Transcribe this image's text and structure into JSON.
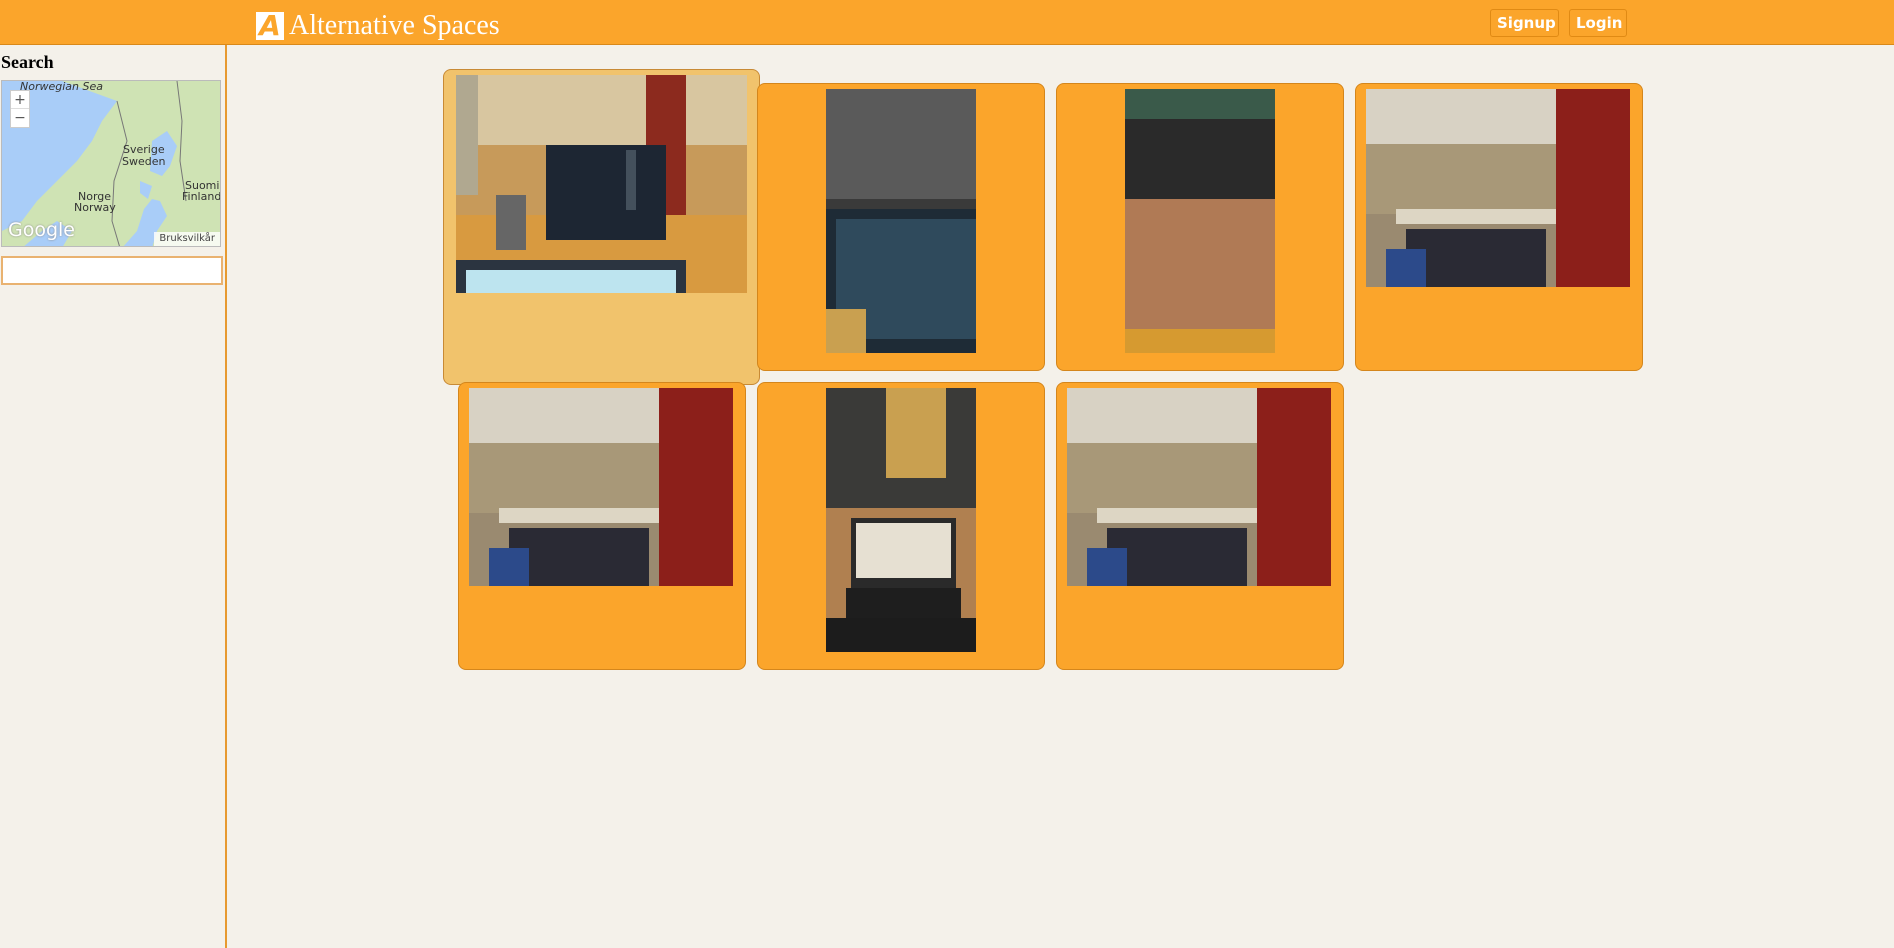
{
  "header": {
    "logo_letter": "A",
    "brand": "Alternative Spaces",
    "signup_label": "Signup",
    "login_label": "Login"
  },
  "sidebar": {
    "title": "Search",
    "map": {
      "labels": {
        "sea": "Norwegian Sea",
        "sweden_local": "Sverige",
        "sweden": "Sweden",
        "norway_local": "Norge",
        "norway": "Norway",
        "finland_local": "Suomi",
        "finland": "Finland"
      },
      "zoom_in": "+",
      "zoom_out": "−",
      "google": "Google",
      "terms": "Bruksvilkår"
    },
    "search_value": ""
  },
  "colors": {
    "header": "#fba52b",
    "card": "#fba52b",
    "card_active": "#f1c36c",
    "background": "#f4f1ea"
  },
  "gallery": {
    "cards": [
      {
        "photo": "office-monitor-photo",
        "active": true
      },
      {
        "photo": "laptop-screen-code-photo",
        "active": false
      },
      {
        "photo": "laptop-keyboard-photo",
        "active": false
      },
      {
        "photo": "open-office-room-photo",
        "active": false
      },
      {
        "photo": "open-office-room-photo",
        "active": false
      },
      {
        "photo": "laptop-by-window-photo",
        "active": false
      },
      {
        "photo": "open-office-room-photo",
        "active": false
      }
    ]
  }
}
